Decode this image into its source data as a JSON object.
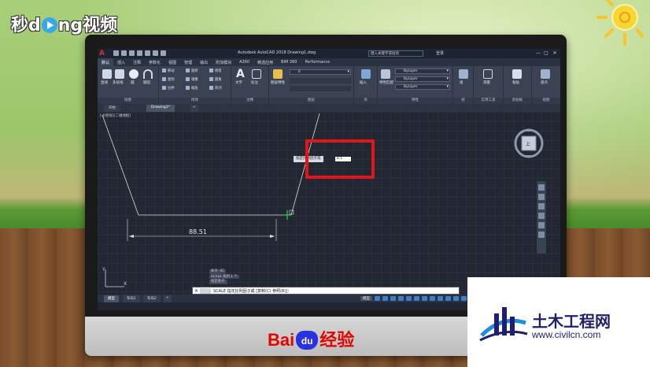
{
  "watermark_left": {
    "part1": "秒",
    "part2": "d",
    "part3": "ng视频"
  },
  "cad": {
    "logo": "A",
    "title": "Autodesk AutoCAD 2018   Drawing1.dwg",
    "search_placeholder": "键入关键字或短语",
    "user": "登录",
    "window_buttons": [
      "—",
      "□",
      "✕"
    ],
    "menu_tabs": [
      "默认",
      "插入",
      "注释",
      "参数化",
      "视图",
      "管理",
      "输出",
      "附加模块",
      "A360",
      "精选应用",
      "BIM 360",
      "Performance"
    ],
    "panels": [
      {
        "label": "绘图",
        "tools": [
          "直线",
          "多段线",
          "圆",
          "圆弧"
        ]
      },
      {
        "label": "修改",
        "tools": [
          "移动",
          "旋转",
          "修剪",
          "复制",
          "镜像",
          "圆角",
          "拉伸",
          "缩放",
          "阵列"
        ]
      },
      {
        "label": "注释",
        "tools": [
          "文字",
          "标注"
        ]
      },
      {
        "label": "图层",
        "tools": [
          "图层特性"
        ],
        "layer_value": "0"
      },
      {
        "label": "块",
        "tools": [
          "插入"
        ]
      },
      {
        "label": "特性",
        "tools": [
          "特性匹配"
        ],
        "bylayer": [
          "ByLayer",
          "ByLayer",
          "ByLayer"
        ]
      },
      {
        "label": "组",
        "tools": [
          "组"
        ]
      },
      {
        "label": "实用工具",
        "tools": [
          "测量"
        ]
      },
      {
        "label": "剪贴板",
        "tools": [
          "粘贴"
        ]
      },
      {
        "label": "视图",
        "tools": [
          "基点"
        ]
      }
    ],
    "doc_tabs": [
      "开始",
      "Drawing1*"
    ],
    "view_label": "[-][俯视][二维线框]",
    "dimension_value": "88.51",
    "dynamic_prompt": "指定比例因子或",
    "dynamic_input_value": "0.1",
    "viewcube_label": "上",
    "history": [
      "命令: SC",
      "SCALE 找到 1 个",
      "指定基点:"
    ],
    "command_line": "SCALE 指定比例因子或 [复制(C) 参照(R)]:",
    "layout_tabs": [
      "模型",
      "布局1",
      "布局2"
    ],
    "status_model": "模型",
    "accent_red": "#e0161b",
    "canvas_bg": "#222733"
  },
  "baidu": {
    "part1": "Bai",
    "paw": "du",
    "part2": "经验"
  },
  "civil_logo": {
    "title": "土木工程网",
    "url": "www.civilcn.com"
  }
}
